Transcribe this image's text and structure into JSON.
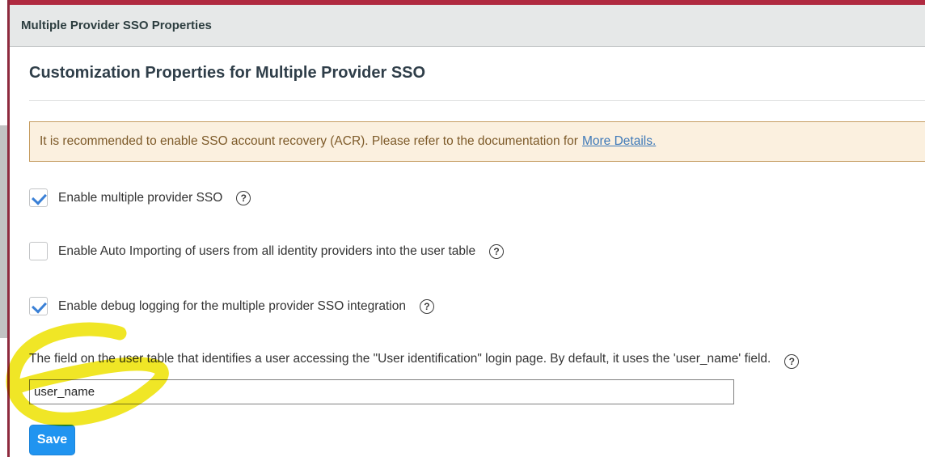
{
  "window": {
    "title": "Multiple Provider SSO Properties"
  },
  "page": {
    "title": "Customization Properties for Multiple Provider SSO"
  },
  "banner": {
    "text": "It is recommended to enable SSO account recovery (ACR). Please refer to the documentation for",
    "link_label": "More Details.",
    "bg_color": "#fbf0df",
    "border_color": "#c69d62",
    "text_color": "#7d5a29",
    "link_color": "#3e79b8"
  },
  "properties": {
    "checkboxes": [
      {
        "label": "Enable multiple provider SSO",
        "checked": true,
        "help_icon": "question-circle"
      },
      {
        "label": "Enable Auto Importing of users from all identity providers into the user table",
        "checked": false,
        "help_icon": "question-circle"
      },
      {
        "label": "Enable debug logging for the multiple provider SSO integration",
        "checked": true,
        "help_icon": "question-circle"
      }
    ],
    "field": {
      "description": "The field on the user table that identifies a user accessing the \"User identification\" login page. By default, it uses the 'user_name' field.",
      "value": "user_name",
      "help_icon": "question-circle"
    }
  },
  "actions": {
    "save_label": "Save",
    "save_color": "#2094f0"
  },
  "help_glyph": "?",
  "annotation": {
    "type": "highlighter-scribble",
    "color": "#efe414",
    "target": "user_name input field"
  },
  "chrome": {
    "frame_color": "#b02a40",
    "header_bg": "#e6e8e8"
  }
}
